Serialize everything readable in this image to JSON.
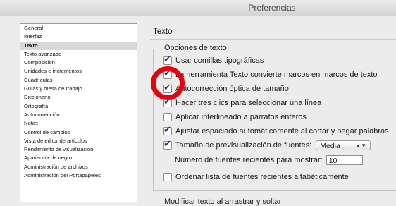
{
  "window": {
    "title": "Preferencias"
  },
  "sidebar": {
    "items": [
      {
        "label": "General"
      },
      {
        "label": "Interfaz"
      },
      {
        "label": "Texto",
        "selected": true
      },
      {
        "label": "Texto avanzado"
      },
      {
        "label": "Composición"
      },
      {
        "label": "Unidades e incrementos"
      },
      {
        "label": "Cuadrículas"
      },
      {
        "label": "Guías y mesa de trabajo"
      },
      {
        "label": "Diccionario"
      },
      {
        "label": "Ortografía"
      },
      {
        "label": "Autocorrección"
      },
      {
        "label": "Notas"
      },
      {
        "label": "Control de cambios"
      },
      {
        "label": "Vista de editor de artículos"
      },
      {
        "label": "Rendimiento de visualización"
      },
      {
        "label": "Apariencia de negro"
      },
      {
        "label": "Administración de archivos"
      },
      {
        "label": "Administración del Portapapeles"
      }
    ]
  },
  "panel": {
    "heading": "Texto",
    "group_label": "Opciones de texto",
    "options": [
      {
        "label": "Usar comillas tipográficas",
        "checked": true
      },
      {
        "label": "La herramienta Texto convierte marcos en marcos de texto",
        "checked": true
      },
      {
        "label": "Autocorrección óptica de tamaño",
        "checked": true
      },
      {
        "label": "Hacer tres clics para seleccionar una línea",
        "checked": true
      },
      {
        "label": "Aplicar interlineado a párrafos enteros",
        "checked": false
      },
      {
        "label": "Ajustar espaciado automáticamente al cortar y pegar palabras",
        "checked": true
      },
      {
        "label": "Tamaño de previsualización de fuentes:",
        "checked": true
      }
    ],
    "preview_size": {
      "value": "Media"
    },
    "recent_fonts": {
      "label": "Número de fuentes recientes para mostrar:",
      "value": "10"
    },
    "sort_recent": {
      "label": "Ordenar lista de fuentes recientes alfabéticamente",
      "checked": false
    },
    "group2_label": "Modificar texto al arrastrar y soltar"
  }
}
